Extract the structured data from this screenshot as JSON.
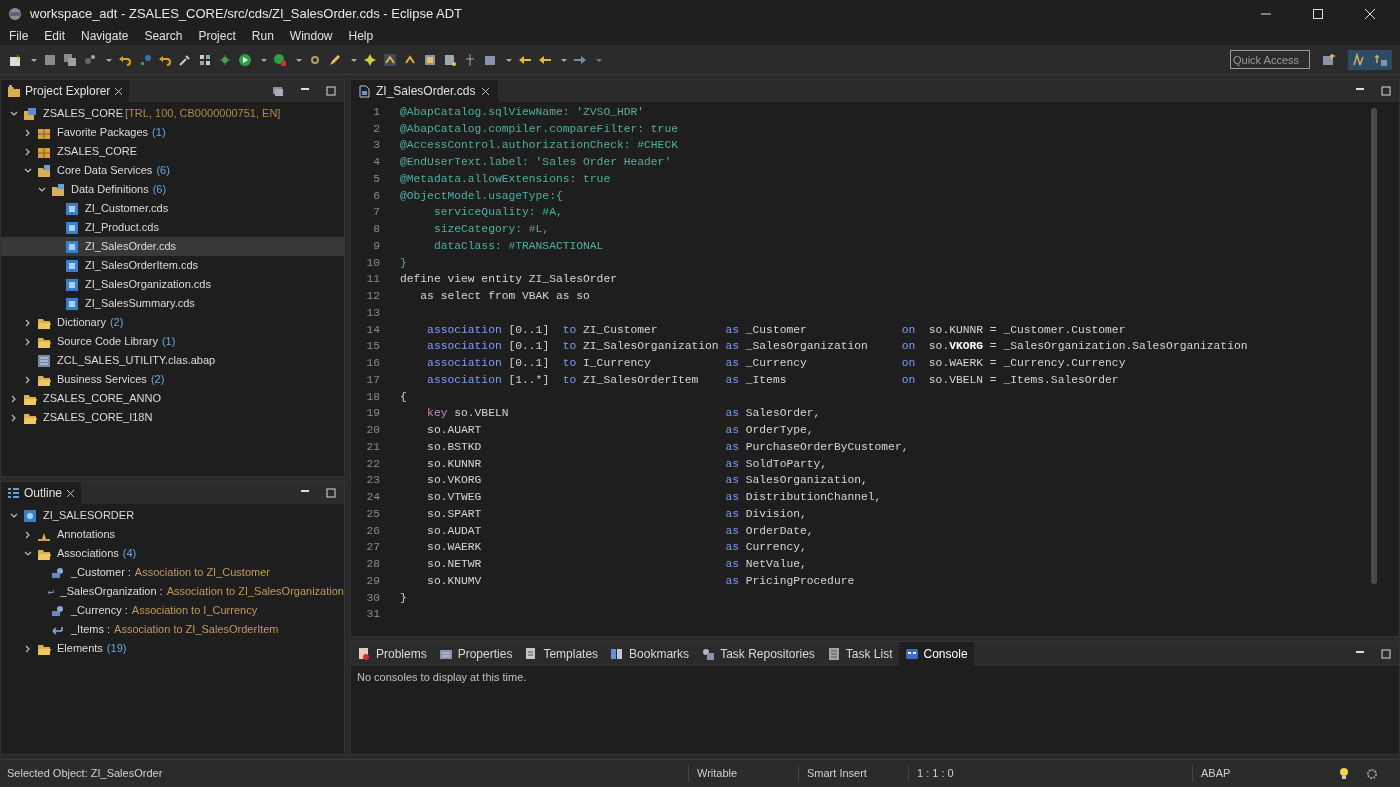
{
  "window": {
    "title": "workspace_adt - ZSALES_CORE/src/cds/ZI_SalesOrder.cds - Eclipse ADT"
  },
  "menu": [
    "File",
    "Edit",
    "Navigate",
    "Search",
    "Project",
    "Run",
    "Window",
    "Help"
  ],
  "quick_access": {
    "placeholder": "Quick Access"
  },
  "project_explorer": {
    "title": "Project Explorer",
    "tree": [
      {
        "kind": "project",
        "label": "ZSALES_CORE",
        "suffix": "[TRL, 100, CB0000000751, EN]",
        "expanded": true,
        "selected": false,
        "children": [
          {
            "kind": "package",
            "label": "Favorite Packages",
            "count": "(1)",
            "expanded": false,
            "selected": false
          },
          {
            "kind": "package",
            "label": "ZSALES_CORE",
            "expanded": false,
            "selected": false
          },
          {
            "kind": "cdsfolder",
            "label": "Core Data Services",
            "count": "(6)",
            "expanded": true,
            "selected": false,
            "children": [
              {
                "kind": "cdsfolder",
                "label": "Data Definitions",
                "count": "(6)",
                "expanded": true,
                "selected": false,
                "children": [
                  {
                    "kind": "cds",
                    "label": "ZI_Customer.cds",
                    "selected": false
                  },
                  {
                    "kind": "cds",
                    "label": "ZI_Product.cds",
                    "selected": false
                  },
                  {
                    "kind": "cds",
                    "label": "ZI_SalesOrder.cds",
                    "selected": true
                  },
                  {
                    "kind": "cds",
                    "label": "ZI_SalesOrderItem.cds",
                    "selected": false
                  },
                  {
                    "kind": "cds",
                    "label": "ZI_SalesOrganization.cds",
                    "selected": false
                  },
                  {
                    "kind": "cds",
                    "label": "ZI_SalesSummary.cds",
                    "selected": false
                  }
                ]
              }
            ]
          },
          {
            "kind": "folder",
            "label": "Dictionary",
            "count": "(2)",
            "expanded": false,
            "selected": false
          },
          {
            "kind": "folder",
            "label": "Source Code Library",
            "count": "(1)",
            "expanded": false,
            "selected": false
          },
          {
            "kind": "class",
            "label": "ZCL_SALES_UTILITY.clas.abap",
            "selected": false
          },
          {
            "kind": "folder",
            "label": "Business Services",
            "count": "(2)",
            "expanded": false,
            "selected": false
          }
        ]
      },
      {
        "kind": "folder",
        "label": "ZSALES_CORE_ANNO",
        "expanded": false,
        "selected": false
      },
      {
        "kind": "folder",
        "label": "ZSALES_CORE_I18N",
        "expanded": false,
        "selected": false
      }
    ]
  },
  "outline": {
    "title": "Outline",
    "tree": [
      {
        "kind": "entity",
        "label": "ZI_SALESORDER",
        "expanded": true,
        "children": [
          {
            "kind": "annotation",
            "label": "Annotations",
            "expanded": false
          },
          {
            "kind": "folder",
            "label": "Associations",
            "count": "(4)",
            "expanded": true,
            "children": [
              {
                "kind": "assoc",
                "label": "_Customer",
                "separator": ":",
                "detail": "Association to ZI_Customer"
              },
              {
                "kind": "assoc2",
                "label": "_SalesOrganization",
                "separator": ":",
                "detail": "Association to ZI_SalesOrganization"
              },
              {
                "kind": "assoc",
                "label": "_Currency",
                "separator": ":",
                "detail": "Association to I_Currency"
              },
              {
                "kind": "assoc2",
                "label": "_Items",
                "separator": ":",
                "detail": "Association to ZI_SalesOrderItem"
              }
            ]
          },
          {
            "kind": "folder",
            "label": "Elements",
            "count": "(19)",
            "expanded": false
          }
        ]
      }
    ]
  },
  "editor": {
    "tab": "ZI_SalesOrder.cds",
    "lines": [
      {
        "number": "1",
        "tokens": [
          {
            "kind": "annotation",
            "text": "@AbapCatalog.sqlViewName: 'ZVSO_HDR'"
          }
        ]
      },
      {
        "number": "2",
        "tokens": [
          {
            "kind": "annotation",
            "text": "@AbapCatalog.compiler.compareFilter: true"
          }
        ]
      },
      {
        "number": "3",
        "tokens": [
          {
            "kind": "annotation",
            "text": "@AccessControl.authorizationCheck: #CHECK"
          }
        ]
      },
      {
        "number": "4",
        "tokens": [
          {
            "kind": "annotation",
            "text": "@EndUserText.label: 'Sales Order Header'"
          }
        ]
      },
      {
        "number": "5",
        "tokens": [
          {
            "kind": "annotation",
            "text": "@Metadata.allowExtensions: true"
          }
        ]
      },
      {
        "number": "6",
        "tokens": [
          {
            "kind": "annotation",
            "text": "@ObjectModel.usageType:{"
          }
        ]
      },
      {
        "number": "7",
        "tokens": [
          {
            "kind": "annotation",
            "text": "     serviceQuality: #A,"
          }
        ]
      },
      {
        "number": "8",
        "tokens": [
          {
            "kind": "annotation",
            "text": "     sizeCategory: #L,"
          }
        ]
      },
      {
        "number": "9",
        "tokens": [
          {
            "kind": "annotation",
            "text": "     dataClass: #TRANSACTIONAL"
          }
        ]
      },
      {
        "number": "10",
        "tokens": [
          {
            "kind": "annotation",
            "text": "}"
          }
        ]
      },
      {
        "number": "11",
        "tokens": [
          {
            "kind": "plain",
            "text": "define view entity ZI_SalesOrder"
          }
        ]
      },
      {
        "number": "12",
        "tokens": [
          {
            "kind": "plain",
            "text": "   as select from VBAK as so"
          }
        ]
      },
      {
        "number": "13"
      },
      {
        "number": "14",
        "tokens": [
          {
            "kind": "keyword",
            "text": "    association"
          },
          {
            "kind": "plain",
            "text": " [0..1]  "
          },
          {
            "kind": "keyword",
            "text": "to"
          },
          {
            "kind": "plain",
            "text": " ZI_Customer          "
          },
          {
            "kind": "keyword",
            "text": "as"
          },
          {
            "kind": "plain",
            "text": " _Customer              "
          },
          {
            "kind": "keyword",
            "text": "on"
          },
          {
            "kind": "plain",
            "text": "  so.KUNNR = _Customer.Customer"
          }
        ]
      },
      {
        "number": "15",
        "tokens": [
          {
            "kind": "keyword",
            "text": "    association"
          },
          {
            "kind": "plain",
            "text": " [0..1]  "
          },
          {
            "kind": "keyword",
            "text": "to"
          },
          {
            "kind": "plain",
            "text": " ZI_SalesOrganization "
          },
          {
            "kind": "keyword",
            "text": "as"
          },
          {
            "kind": "plain",
            "text": " _SalesOrganization     "
          },
          {
            "kind": "keyword",
            "text": "on"
          },
          {
            "kind": "plain",
            "text": "  so."
          },
          {
            "kind": "highlight",
            "text": "VKORG"
          },
          {
            "kind": "plain",
            "text": " = _SalesOrganization.SalesOrganization"
          }
        ]
      },
      {
        "number": "16",
        "tokens": [
          {
            "kind": "keyword",
            "text": "    association"
          },
          {
            "kind": "plain",
            "text": " [0..1]  "
          },
          {
            "kind": "keyword",
            "text": "to"
          },
          {
            "kind": "plain",
            "text": " I_Currency           "
          },
          {
            "kind": "keyword",
            "text": "as"
          },
          {
            "kind": "plain",
            "text": " _Currency              "
          },
          {
            "kind": "keyword",
            "text": "on"
          },
          {
            "kind": "plain",
            "text": "  so.WAERK = _Currency.Currency"
          }
        ]
      },
      {
        "number": "17",
        "tokens": [
          {
            "kind": "keyword",
            "text": "    association"
          },
          {
            "kind": "plain",
            "text": " [1..*]  "
          },
          {
            "kind": "keyword",
            "text": "to"
          },
          {
            "kind": "plain",
            "text": " ZI_SalesOrderItem    "
          },
          {
            "kind": "keyword",
            "text": "as"
          },
          {
            "kind": "plain",
            "text": " _Items                 "
          },
          {
            "kind": "keyword",
            "text": "on"
          },
          {
            "kind": "plain",
            "text": "  so.VBELN = _Items.SalesOrder"
          }
        ]
      },
      {
        "number": "18",
        "tokens": [
          {
            "kind": "plain",
            "text": "{"
          }
        ]
      },
      {
        "number": "19",
        "tokens": [
          {
            "kind": "key",
            "text": "    key"
          },
          {
            "kind": "plain",
            "text": " so.VBELN                                "
          },
          {
            "kind": "keyword",
            "text": "as"
          },
          {
            "kind": "plain",
            "text": " SalesOrder,"
          }
        ]
      },
      {
        "number": "20",
        "tokens": [
          {
            "kind": "plain",
            "text": "    so.AUART                                    "
          },
          {
            "kind": "keyword",
            "text": "as"
          },
          {
            "kind": "plain",
            "text": " OrderType,"
          }
        ]
      },
      {
        "number": "21",
        "tokens": [
          {
            "kind": "plain",
            "text": "    so.BSTKD                                    "
          },
          {
            "kind": "keyword",
            "text": "as"
          },
          {
            "kind": "plain",
            "text": " PurchaseOrderByCustomer,"
          }
        ]
      },
      {
        "number": "22",
        "tokens": [
          {
            "kind": "plain",
            "text": "    so.KUNNR                                    "
          },
          {
            "kind": "keyword",
            "text": "as"
          },
          {
            "kind": "plain",
            "text": " SoldToParty,"
          }
        ]
      },
      {
        "number": "23",
        "tokens": [
          {
            "kind": "plain",
            "text": "    so.VKORG                                    "
          },
          {
            "kind": "keyword",
            "text": "as"
          },
          {
            "kind": "plain",
            "text": " SalesOrganization,"
          }
        ]
      },
      {
        "number": "24",
        "tokens": [
          {
            "kind": "plain",
            "text": "    so.VTWEG                                    "
          },
          {
            "kind": "keyword",
            "text": "as"
          },
          {
            "kind": "plain",
            "text": " DistributionChannel,"
          }
        ]
      },
      {
        "number": "25",
        "tokens": [
          {
            "kind": "plain",
            "text": "    so.SPART                                    "
          },
          {
            "kind": "keyword",
            "text": "as"
          },
          {
            "kind": "plain",
            "text": " Division,"
          }
        ]
      },
      {
        "number": "26",
        "tokens": [
          {
            "kind": "plain",
            "text": "    so.AUDAT                                    "
          },
          {
            "kind": "keyword",
            "text": "as"
          },
          {
            "kind": "plain",
            "text": " OrderDate,"
          }
        ]
      },
      {
        "number": "27",
        "tokens": [
          {
            "kind": "plain",
            "text": "    so.WAERK                                    "
          },
          {
            "kind": "keyword",
            "text": "as"
          },
          {
            "kind": "plain",
            "text": " Currency,"
          }
        ]
      },
      {
        "number": "28",
        "tokens": [
          {
            "kind": "plain",
            "text": "    so.NETWR                                    "
          },
          {
            "kind": "keyword",
            "text": "as"
          },
          {
            "kind": "plain",
            "text": " NetValue,"
          }
        ]
      },
      {
        "number": "29",
        "tokens": [
          {
            "kind": "plain",
            "text": "    so.KNUMV                                    "
          },
          {
            "kind": "keyword",
            "text": "as"
          },
          {
            "kind": "plain",
            "text": " PricingProcedure"
          }
        ]
      },
      {
        "number": "30",
        "tokens": [
          {
            "kind": "plain",
            "text": "}"
          }
        ]
      },
      {
        "number": "31"
      }
    ]
  },
  "bottom_panel": {
    "tabs": [
      {
        "kind": "problems",
        "label": "Problems",
        "selected": false
      },
      {
        "kind": "properties",
        "label": "Properties",
        "selected": false
      },
      {
        "kind": "templates",
        "label": "Templates",
        "selected": false
      },
      {
        "kind": "bookmarks",
        "label": "Bookmarks",
        "selected": false
      },
      {
        "kind": "tasks",
        "label": "Task Repositories",
        "selected": false
      },
      {
        "kind": "tasklist",
        "label": "Task List",
        "selected": false
      },
      {
        "kind": "console",
        "label": "Console",
        "selected": true
      }
    ],
    "message": "No consoles to display at this time."
  },
  "status_bar": {
    "selected_object": "Selected Object: ZI_SalesOrder",
    "mode": "Writable",
    "insert": "Smart Insert",
    "position": "1 : 1 : 0",
    "language": "ABAP"
  }
}
